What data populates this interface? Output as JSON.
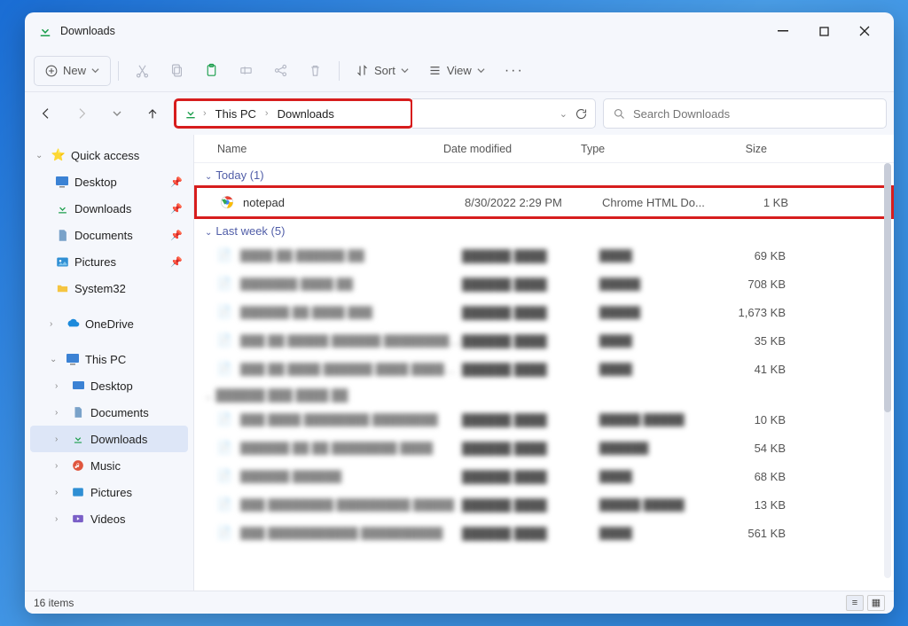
{
  "window": {
    "title": "Downloads"
  },
  "toolbar": {
    "new": "New",
    "sort": "Sort",
    "view": "View"
  },
  "breadcrumb": {
    "items": [
      "This PC",
      "Downloads"
    ]
  },
  "search": {
    "placeholder": "Search Downloads"
  },
  "sidebar": {
    "quick_access": "Quick access",
    "desktop": "Desktop",
    "downloads": "Downloads",
    "documents": "Documents",
    "pictures": "Pictures",
    "system32": "System32",
    "onedrive": "OneDrive",
    "this_pc": "This PC",
    "pc_desktop": "Desktop",
    "pc_documents": "Documents",
    "pc_downloads": "Downloads",
    "pc_music": "Music",
    "pc_pictures": "Pictures",
    "pc_videos": "Videos"
  },
  "columns": {
    "name": "Name",
    "date": "Date modified",
    "type": "Type",
    "size": "Size"
  },
  "groups": {
    "today": "Today (1)",
    "last_week": "Last week (5)"
  },
  "files": {
    "today": [
      {
        "name": "notepad",
        "date": "8/30/2022 2:29 PM",
        "type": "Chrome HTML Do...",
        "size": "1 KB"
      }
    ],
    "last_week_sizes": [
      "69 KB",
      "708 KB",
      "1,673 KB",
      "35 KB",
      "41 KB"
    ],
    "earlier_sizes": [
      "10 KB",
      "54 KB",
      "68 KB",
      "13 KB",
      "561 KB"
    ]
  },
  "status": {
    "text": "16 items"
  }
}
